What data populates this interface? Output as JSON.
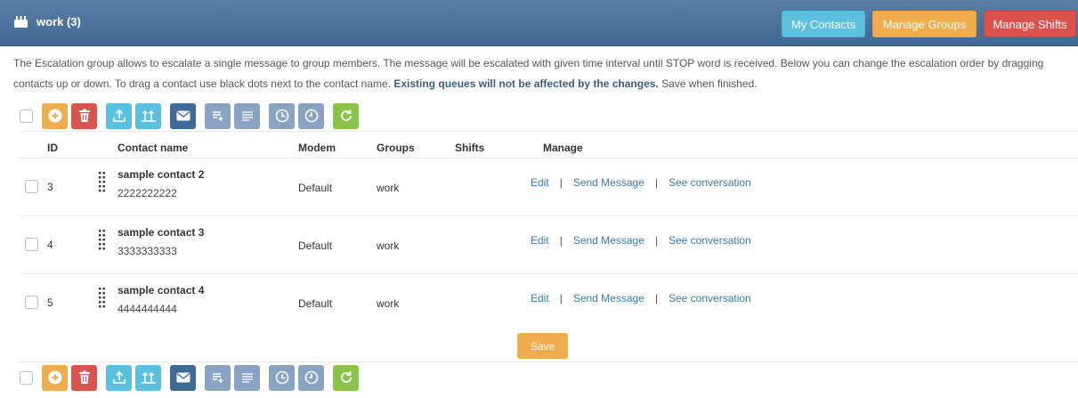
{
  "header": {
    "title": "work (3)",
    "buttons": {
      "my_contacts": "My Contacts",
      "manage_groups": "Manage Groups",
      "manage_shifts": "Manage Shifts"
    }
  },
  "description": {
    "text": "The Escalation group allows to escalate a single message to group members. The message will be escalated with given time interval until STOP word is received. Below you can change the escalation order by dragging contacts up or down. To drag a contact use black dots next to the contact name.",
    "bold": "Existing queues will not be affected by the changes.",
    "tail": "Save when finished."
  },
  "table": {
    "columns": {
      "id": "ID",
      "contact_name": "Contact name",
      "modem": "Modem",
      "groups": "Groups",
      "shifts": "Shifts",
      "manage": "Manage"
    },
    "rows": [
      {
        "id": "3",
        "name": "sample contact 2",
        "number": "2222222222",
        "modem": "Default",
        "group": "work",
        "shifts": ""
      },
      {
        "id": "4",
        "name": "sample contact 3",
        "number": "3333333333",
        "modem": "Default",
        "group": "work",
        "shifts": ""
      },
      {
        "id": "5",
        "name": "sample contact 4",
        "number": "4444444444",
        "modem": "Default",
        "group": "work",
        "shifts": ""
      }
    ],
    "actions": {
      "edit": "Edit",
      "separator": "|",
      "send_message": "Send Message",
      "see_conversation": "See conversation"
    }
  },
  "save_label": "Save",
  "toolbar_icons": [
    "add-icon",
    "delete-icon",
    "upload-icon",
    "upload-all-icon",
    "envelope-icon",
    "list-add-icon",
    "list-icon",
    "clock-icon",
    "clock-alt-icon",
    "refresh-icon"
  ],
  "colors": {
    "header_bg": "#4a6f99",
    "info": "#5bc0de",
    "warning": "#f0ad4e",
    "danger": "#d9534f",
    "success": "#8bc34a",
    "link": "#337ab7"
  }
}
